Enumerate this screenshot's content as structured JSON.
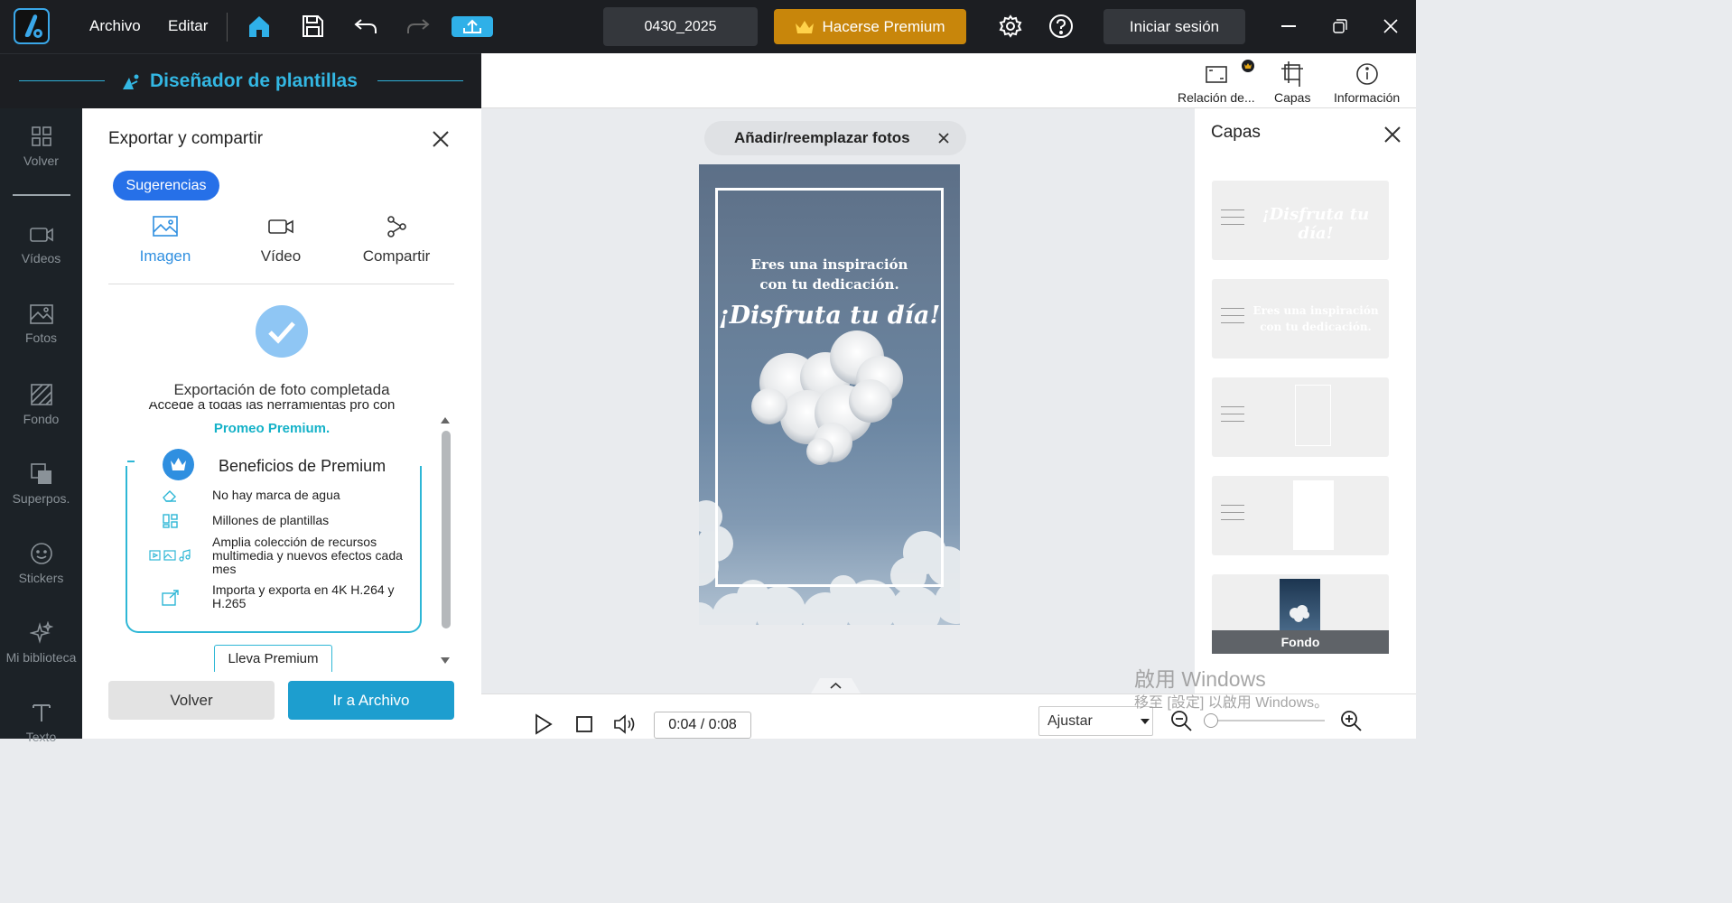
{
  "topbar": {
    "menu": [
      "Archivo",
      "Editar"
    ],
    "project_name": "0430_2025",
    "premium_label": "Hacerse Premium",
    "login_label": "Iniciar sesión"
  },
  "designer": {
    "title": "Diseñador de plantillas"
  },
  "sidebar": {
    "items": [
      {
        "label": "Volver",
        "icon": "grid-icon"
      },
      {
        "label": "Vídeos",
        "icon": "video-icon"
      },
      {
        "label": "Fotos",
        "icon": "photo-icon"
      },
      {
        "label": "Fondo",
        "icon": "background-icon"
      },
      {
        "label": "Superpos.",
        "icon": "overlay-icon"
      },
      {
        "label": "Stickers",
        "icon": "sticker-icon"
      },
      {
        "label": "Mi biblioteca",
        "icon": "sparkle-icon"
      },
      {
        "label": "Texto",
        "icon": "text-icon"
      }
    ]
  },
  "export": {
    "title": "Exportar y compartir",
    "chip": "Sugerencias",
    "tabs": [
      {
        "label": "Imagen",
        "active": true
      },
      {
        "label": "Vídeo",
        "active": false
      },
      {
        "label": "Compartir",
        "active": false
      }
    ],
    "done_text": "Exportación de foto completada",
    "promo_line": "Accede a todas las herramientas pro con",
    "promo_link": "Promeo Premium.",
    "benefits_title": "Beneficios de Premium",
    "benefits": [
      "No hay marca de agua",
      "Millones de plantillas",
      "Amplia colección de recursos multimedia y nuevos efectos cada mes",
      "Importa y exporta en 4K H.264 y H.265"
    ],
    "lleva_label": "Lleva Premium",
    "back_label": "Volver",
    "go_label": "Ir a Archivo"
  },
  "canvas": {
    "add_photos": "Añadir/reemplazar fotos",
    "quote_line1": "Eres una inspiración",
    "quote_line2": "con tu dedicación.",
    "quote_script": "¡Disfruta tu día!"
  },
  "right_tools": [
    {
      "label": "Relación de...",
      "icon": "aspect-ratio-icon"
    },
    {
      "label": "Capas",
      "icon": "layers-icon"
    },
    {
      "label": "Información",
      "icon": "info-icon"
    }
  ],
  "layers": {
    "title": "Capas",
    "items": [
      {
        "type": "script",
        "text": "¡Disfruta tu día!"
      },
      {
        "type": "text",
        "line1": "Eres una inspiración",
        "line2": "con tu dedicación."
      },
      {
        "type": "frame"
      },
      {
        "type": "white"
      },
      {
        "type": "background",
        "label": "Fondo"
      }
    ]
  },
  "player": {
    "time": "0:04 / 0:08",
    "fit_value": "Ajustar",
    "zoom_level": 0
  },
  "watermark": {
    "line1": "啟用 Windows",
    "line2": "移至 [設定] 以啟用 Windows。"
  },
  "colors": {
    "accent": "#2fb0d8",
    "premium": "#c8860b",
    "primary_button": "#1d9ecf",
    "chip": "#2670e8"
  }
}
